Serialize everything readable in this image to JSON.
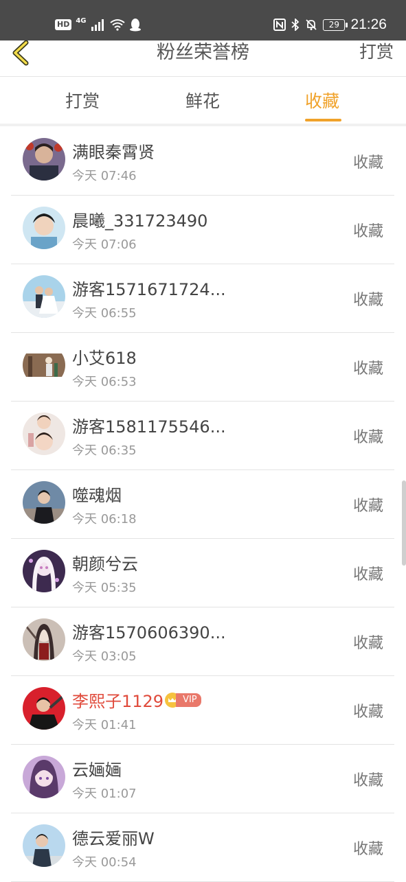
{
  "status_bar": {
    "hd": "HD",
    "network": "4G",
    "battery": "29",
    "time": "21:26"
  },
  "header": {
    "title": "粉丝荣誉榜",
    "right_action": "打赏"
  },
  "tabs": [
    {
      "label": "打赏",
      "active": false
    },
    {
      "label": "鲜花",
      "active": false
    },
    {
      "label": "收藏",
      "active": true
    }
  ],
  "accent_color": "#f0a22a",
  "fans": [
    {
      "name": "满眼秦霄贤",
      "time": "今天 07:46",
      "action": "收藏"
    },
    {
      "name": "晨曦_331723490",
      "time": "今天 07:06",
      "action": "收藏"
    },
    {
      "name": "游客1571671724...",
      "time": "今天 06:55",
      "action": "收藏"
    },
    {
      "name": "小艾618",
      "time": "今天 06:53",
      "action": "收藏"
    },
    {
      "name": "游客1581175546...",
      "time": "今天 06:35",
      "action": "收藏"
    },
    {
      "name": "噬魂烟",
      "time": "今天 06:18",
      "action": "收藏"
    },
    {
      "name": "朝颜兮云",
      "time": "今天 05:35",
      "action": "收藏"
    },
    {
      "name": "游客1570606390...",
      "time": "今天 03:05",
      "action": "收藏"
    },
    {
      "name": "李熙子1129",
      "time": "今天 01:41",
      "action": "收藏",
      "vip_label": "VIP"
    },
    {
      "name": "云婳婳",
      "time": "今天 01:07",
      "action": "收藏"
    },
    {
      "name": "德云爱丽W",
      "time": "今天 00:54",
      "action": "收藏"
    }
  ]
}
